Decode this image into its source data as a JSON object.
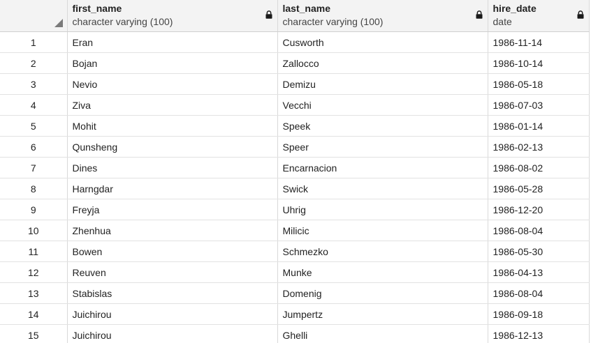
{
  "columns": [
    {
      "name": "first_name",
      "type": "character varying (100)",
      "locked": true
    },
    {
      "name": "last_name",
      "type": "character varying (100)",
      "locked": true
    },
    {
      "name": "hire_date",
      "type": "date",
      "locked": true
    }
  ],
  "rows": [
    {
      "num": "1",
      "first_name": "Eran",
      "last_name": "Cusworth",
      "hire_date": "1986-11-14"
    },
    {
      "num": "2",
      "first_name": "Bojan",
      "last_name": "Zallocco",
      "hire_date": "1986-10-14"
    },
    {
      "num": "3",
      "first_name": "Nevio",
      "last_name": "Demizu",
      "hire_date": "1986-05-18"
    },
    {
      "num": "4",
      "first_name": "Ziva",
      "last_name": "Vecchi",
      "hire_date": "1986-07-03"
    },
    {
      "num": "5",
      "first_name": "Mohit",
      "last_name": "Speek",
      "hire_date": "1986-01-14"
    },
    {
      "num": "6",
      "first_name": "Qunsheng",
      "last_name": "Speer",
      "hire_date": "1986-02-13"
    },
    {
      "num": "7",
      "first_name": "Dines",
      "last_name": "Encarnacion",
      "hire_date": "1986-08-02"
    },
    {
      "num": "8",
      "first_name": "Harngdar",
      "last_name": "Swick",
      "hire_date": "1986-05-28"
    },
    {
      "num": "9",
      "first_name": "Freyja",
      "last_name": "Uhrig",
      "hire_date": "1986-12-20"
    },
    {
      "num": "10",
      "first_name": "Zhenhua",
      "last_name": "Milicic",
      "hire_date": "1986-08-04"
    },
    {
      "num": "11",
      "first_name": "Bowen",
      "last_name": "Schmezko",
      "hire_date": "1986-05-30"
    },
    {
      "num": "12",
      "first_name": "Reuven",
      "last_name": "Munke",
      "hire_date": "1986-04-13"
    },
    {
      "num": "13",
      "first_name": "Stabislas",
      "last_name": "Domenig",
      "hire_date": "1986-08-04"
    },
    {
      "num": "14",
      "first_name": "Juichirou",
      "last_name": "Jumpertz",
      "hire_date": "1986-09-18"
    },
    {
      "num": "15",
      "first_name": "Juichirou",
      "last_name": "Ghelli",
      "hire_date": "1986-12-13"
    }
  ]
}
